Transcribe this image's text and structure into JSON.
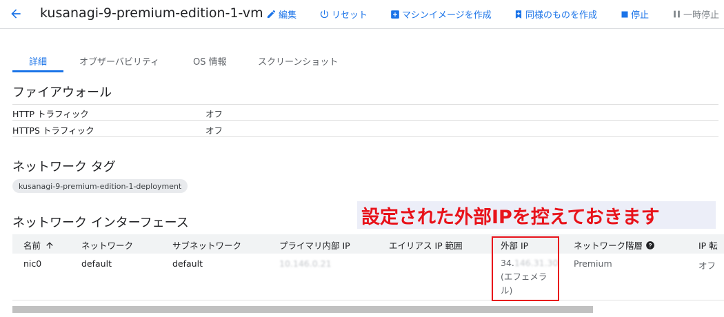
{
  "header": {
    "title": "kusanagi-9-premium-edition-1-vm",
    "actions": {
      "edit": "編集",
      "reset": "リセット",
      "machine_image": "マシンイメージを作成",
      "create_similar": "同様のものを作成",
      "stop": "停止",
      "suspend": "一時停止"
    }
  },
  "tabs": [
    "詳細",
    "オブザーバビリティ",
    "OS 情報",
    "スクリーンショット"
  ],
  "firewall": {
    "title": "ファイアウォール",
    "rows": [
      {
        "key": "HTTP トラフィック",
        "value": "オフ"
      },
      {
        "key": "HTTPS トラフィック",
        "value": "オフ"
      }
    ]
  },
  "network_tags": {
    "title": "ネットワーク タグ",
    "tag": "kusanagi-9-premium-edition-1-deployment"
  },
  "annotation": "設定された外部IPを控えておきます",
  "interfaces": {
    "title": "ネットワーク インターフェース",
    "columns": {
      "name": "名前",
      "network": "ネットワーク",
      "subnet": "サブネットワーク",
      "primary_ip": "プライマリ内部 IP",
      "alias_ip": "エイリアス IP 範囲",
      "external_ip": "外部 IP",
      "tier": "ネットワーク階層",
      "ip_forward": "IP 転"
    },
    "row": {
      "name": "nic0",
      "network": "default",
      "subnet": "default",
      "primary_ip": "10.146.0.21",
      "alias_ip": "",
      "external_ip_prefix": "34.",
      "external_ip_rest": "146.31.30",
      "external_ip_type_line1": "(エフェメラ",
      "external_ip_type_line2": "ル)",
      "tier": "Premium",
      "ip_forward": "オフ"
    }
  },
  "colors": {
    "accent": "#1a73e8",
    "annotation_red": "#e8121a",
    "annotation_bg": "#eceef8"
  }
}
